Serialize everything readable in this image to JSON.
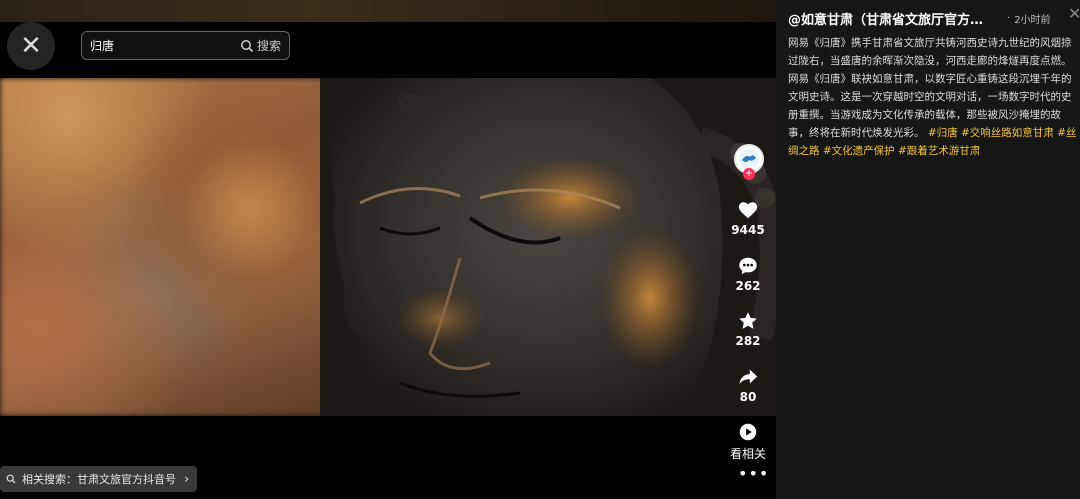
{
  "search": {
    "value": "归唐",
    "button_label": "搜索"
  },
  "actions": {
    "like_count": "9445",
    "comment_count": "262",
    "favorite_count": "282",
    "share_count": "80",
    "related_label": "看相关"
  },
  "related_search": {
    "prefix": "相关搜索：",
    "query": "甘肃文旅官方抖音号"
  },
  "panel": {
    "author": "@如意甘肃（甘肃省文旅厅官方…",
    "time": "2小时前",
    "description": "网易《归唐》携手甘肃省文旅厅共铸河西史诗九世纪的风烟掠过陇右，当盛唐的余晖渐次隐没，河西走廊的烽燧再度点燃。网易《归唐》联袂如意甘肃，以数字匠心重铸这段沉埋千年的文明史诗。这是一次穿越时空的文明对话，一场数字时代的史册重撰。当游戏成为文化传承的载体，那些被风沙掩埋的故事，终将在新时代焕发光彩。",
    "hashtags": [
      "#归唐",
      "#交响丝路如意甘肃",
      "#丝绸之路",
      "#文化遗产保护",
      "#跟着艺术游甘肃"
    ]
  },
  "colors": {
    "accent": "#fe2c55",
    "hashtag": "#f6c440",
    "panel_bg": "#161616"
  },
  "icons": [
    "close-icon",
    "search-icon",
    "heart-icon",
    "comment-icon",
    "star-icon",
    "share-icon",
    "play-icon",
    "more-icon",
    "chevron-right-icon"
  ]
}
